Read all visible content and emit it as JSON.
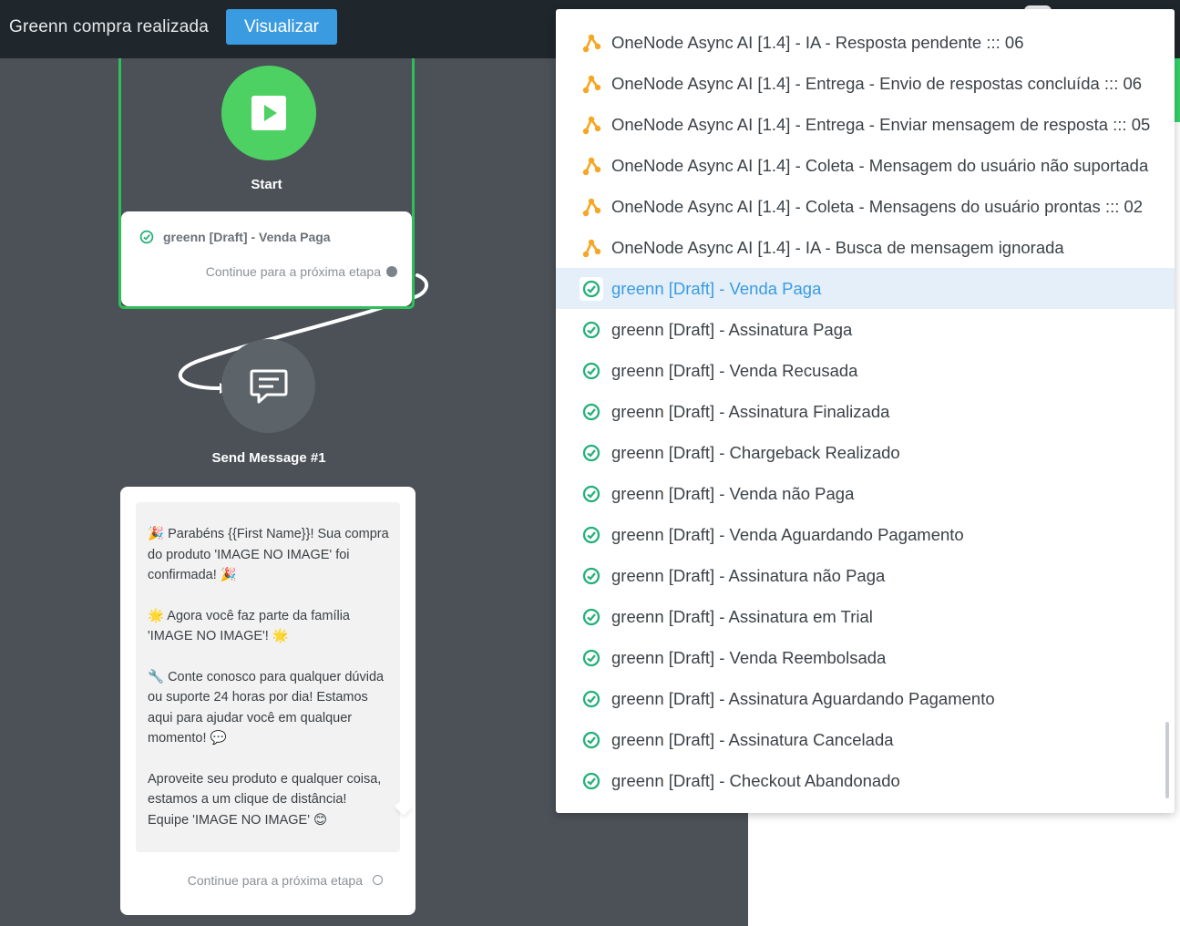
{
  "header": {
    "flow_title": "Greenn compra realizada",
    "view_button": "Visualizar"
  },
  "start_node": {
    "label": "Start",
    "trigger": "greenn [Draft] - Venda Paga",
    "continue_text": "Continue para a próxima etapa"
  },
  "message_node": {
    "label": "Send Message #1",
    "paragraphs": [
      "🎉 Parabéns {{First Name}}! Sua compra do produto 'IMAGE NO IMAGE' foi confirmada! 🎉",
      "🌟 Agora você faz parte da família 'IMAGE NO IMAGE'! 🌟",
      "🔧 Conte conosco para qualquer dúvida ou suporte 24 horas por dia! Estamos aqui para ajudar você em qualquer momento! 💬",
      "Aproveite seu produto e qualquer coisa, estamos a um clique de distância! Equipe 'IMAGE NO IMAGE' 😊"
    ],
    "continue_text": "Continue para a próxima etapa"
  },
  "dropdown": {
    "selected_index": 6,
    "items": [
      {
        "label": "OneNode Async AI [1.4] - IA - Resposta pendente ::: 06",
        "icon": "webhook-icon"
      },
      {
        "label": "OneNode Async AI [1.4] - Entrega - Envio de respostas concluída ::: 06",
        "icon": "webhook-icon"
      },
      {
        "label": "OneNode Async AI [1.4] - Entrega - Enviar mensagem de resposta ::: 05",
        "icon": "webhook-icon"
      },
      {
        "label": "OneNode Async AI [1.4] - Coleta - Mensagem do usuário não suportada",
        "icon": "webhook-icon"
      },
      {
        "label": "OneNode Async AI [1.4] - Coleta - Mensagens do usuário prontas ::: 02",
        "icon": "webhook-icon"
      },
      {
        "label": "OneNode Async AI [1.4] - IA - Busca de mensagem ignorada",
        "icon": "webhook-icon"
      },
      {
        "label": "greenn [Draft] - Venda Paga",
        "icon": "greenn-check-icon"
      },
      {
        "label": "greenn [Draft] - Assinatura Paga",
        "icon": "greenn-check-icon"
      },
      {
        "label": "greenn [Draft] - Venda Recusada",
        "icon": "greenn-check-icon"
      },
      {
        "label": "greenn [Draft] - Assinatura Finalizada",
        "icon": "greenn-check-icon"
      },
      {
        "label": "greenn [Draft] - Chargeback Realizado",
        "icon": "greenn-check-icon"
      },
      {
        "label": "greenn [Draft] - Venda não Paga",
        "icon": "greenn-check-icon"
      },
      {
        "label": "greenn [Draft] - Venda Aguardando Pagamento",
        "icon": "greenn-check-icon"
      },
      {
        "label": "greenn [Draft] - Assinatura não Paga",
        "icon": "greenn-check-icon"
      },
      {
        "label": "greenn [Draft] - Assinatura em Trial",
        "icon": "greenn-check-icon"
      },
      {
        "label": "greenn [Draft] - Venda Reembolsada",
        "icon": "greenn-check-icon"
      },
      {
        "label": "greenn [Draft] - Assinatura Aguardando Pagamento",
        "icon": "greenn-check-icon"
      },
      {
        "label": "greenn [Draft] - Assinatura Cancelada",
        "icon": "greenn-check-icon"
      },
      {
        "label": "greenn [Draft] - Checkout Abandonado",
        "icon": "greenn-check-icon"
      }
    ]
  },
  "colors": {
    "topbar": "#1f262c",
    "canvas": "#4b5157",
    "accent_blue": "#3a9be0",
    "start_green": "#4cd162",
    "webhook_orange": "#f5a623",
    "greenn_check": "#25b07a"
  }
}
